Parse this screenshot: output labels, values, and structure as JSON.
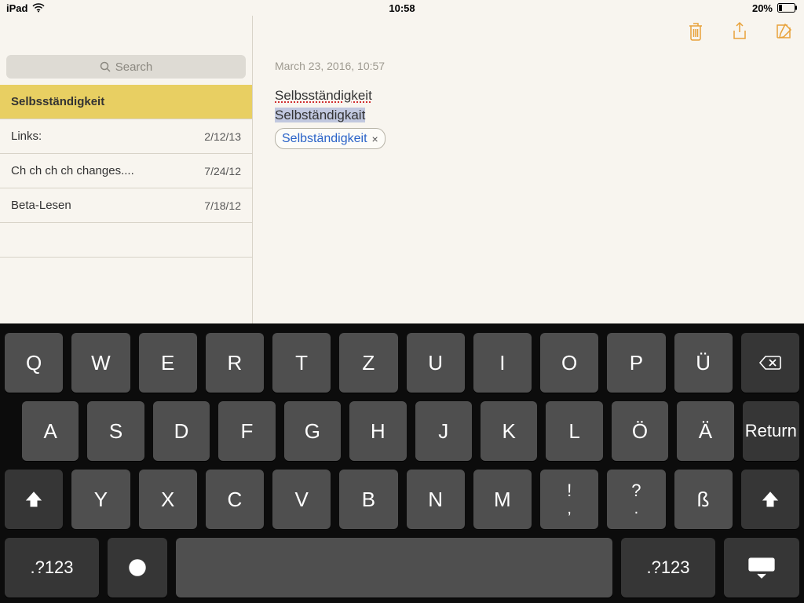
{
  "status": {
    "device": "iPad",
    "time": "10:58",
    "battery_pct": "20%"
  },
  "toolbar": {
    "trash": "trash",
    "share": "share",
    "compose": "compose"
  },
  "search": {
    "placeholder": "Search"
  },
  "notes": [
    {
      "title": "Selbsständigkeit",
      "date": "",
      "selected": true
    },
    {
      "title": "Links:",
      "date": "2/12/13",
      "selected": false
    },
    {
      "title": "Ch ch ch ch changes....",
      "date": "7/24/12",
      "selected": false
    },
    {
      "title": "Beta-Lesen",
      "date": "7/18/12",
      "selected": false
    }
  ],
  "note": {
    "timestamp": "March 23, 2016, 10:57",
    "line1": "Selbsständigkeit",
    "line2": "Selbständigkait",
    "suggestion": "Selbständigkeit",
    "suggestion_close": "×"
  },
  "keyboard": {
    "row1": [
      "Q",
      "W",
      "E",
      "R",
      "T",
      "Z",
      "U",
      "I",
      "O",
      "P",
      "Ü"
    ],
    "backspace": "⌫",
    "row2": [
      "A",
      "S",
      "D",
      "F",
      "G",
      "H",
      "J",
      "K",
      "L",
      "Ö",
      "Ä"
    ],
    "return": "Return",
    "row3_letters": [
      "Y",
      "X",
      "C",
      "V",
      "B",
      "N",
      "M"
    ],
    "punct1_top": "!",
    "punct1_bot": ",",
    "punct2_top": "?",
    "punct2_bot": ".",
    "eszett": "ß",
    "numsym": ".?123",
    "space": " "
  }
}
